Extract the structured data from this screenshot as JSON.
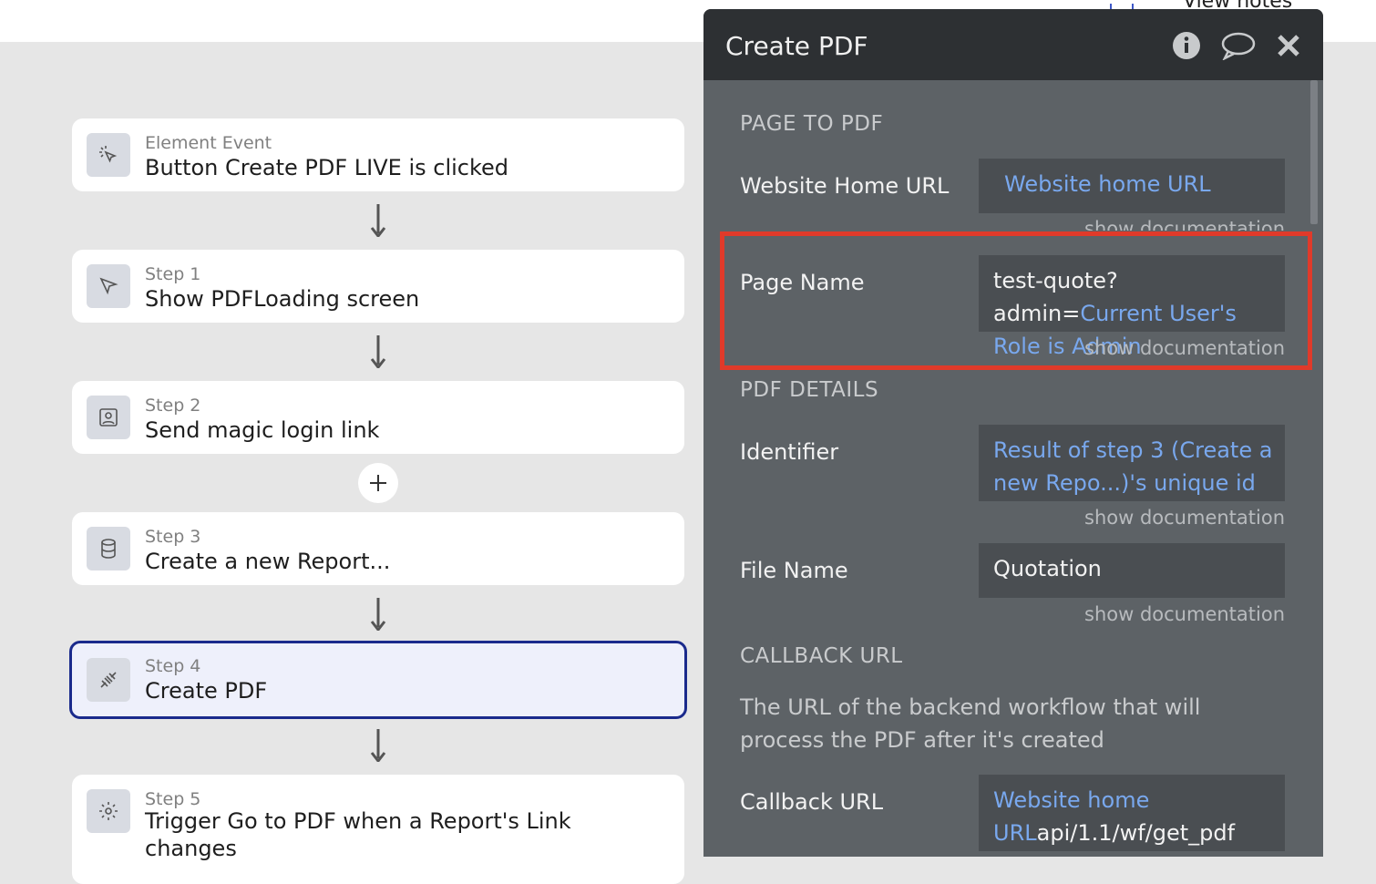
{
  "topbar": {
    "notes_label": "View notes"
  },
  "workflow": {
    "event": {
      "label": "Element Event",
      "title": "Button Create PDF LIVE is clicked",
      "icon": "cursor-click-icon"
    },
    "steps": [
      {
        "label": "Step 1",
        "title": "Show PDFLoading screen",
        "icon": "pointer-icon"
      },
      {
        "label": "Step 2",
        "title": "Send magic login link",
        "icon": "user-card-icon"
      },
      {
        "label": "Step 3",
        "title": "Create a new Report...",
        "icon": "database-icon"
      },
      {
        "label": "Step 4",
        "title": "Create PDF",
        "icon": "plug-icon"
      },
      {
        "label": "Step 5",
        "title": "Trigger Go to PDF when a Report's Link changes",
        "icon": "gear-icon"
      }
    ]
  },
  "panel": {
    "title": "Create PDF",
    "section_page": "PAGE TO PDF",
    "website_home_url": {
      "label": "Website Home URL",
      "value": "Website home URL",
      "doc": "show documentation"
    },
    "page_name": {
      "label": "Page Name",
      "static": "test-quote?admin=",
      "dynamic": "Current User's Role is Admin",
      "doc": "show documentation"
    },
    "section_details": "PDF DETAILS",
    "identifier": {
      "label": "Identifier",
      "value": "Result of step 3 (Create a new Repo...)'s unique id",
      "doc": "show documentation"
    },
    "file_name": {
      "label": "File Name",
      "value": "Quotation",
      "doc": "show documentation"
    },
    "section_callback": "CALLBACK URL",
    "callback_desc": "The URL of the backend workflow that will process the PDF after it's created",
    "callback_url": {
      "label": "Callback URL",
      "dynamic": "Website home URL",
      "static": "api/1.1/wf/get_pdf"
    }
  },
  "colors": {
    "panel_bg": "#5d6266",
    "header_bg": "#2d3033",
    "dynamic_text": "#79a8ee",
    "highlight": "#e03a2a",
    "selected_border": "#1a2a8c"
  }
}
